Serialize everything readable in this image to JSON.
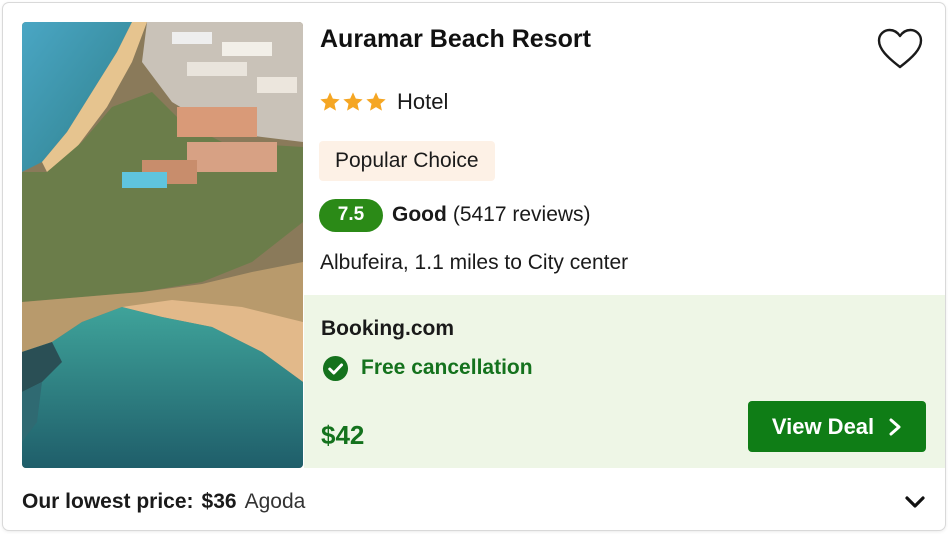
{
  "hotel": {
    "name": "Auramar Beach Resort",
    "star_count": 3,
    "type_label": "Hotel",
    "badge": "Popular Choice",
    "rating": {
      "score": "7.5",
      "label": "Good",
      "reviews": "(5417 reviews)"
    },
    "location": "Albufeira, 1.1 miles to City center",
    "photo_icon": "hotel-photo"
  },
  "deal": {
    "provider": "Booking.com",
    "cancellation": "Free cancellation",
    "price": "$42",
    "button_label": "View Deal"
  },
  "lowest_price": {
    "label": "Our lowest price:",
    "price": "$36",
    "provider": "Agoda"
  },
  "icons": {
    "favorite": "heart-icon",
    "star": "star-icon",
    "check": "check-circle-icon",
    "next": "chevron-right-icon",
    "expand": "chevron-down-icon"
  },
  "colors": {
    "star": "#f5a623",
    "score_bg": "#2b8a17",
    "deal_bg": "#eef6e6",
    "deal_green": "#14721d",
    "button_bg": "#0f7d16",
    "badge_bg": "#fdf1e6"
  }
}
